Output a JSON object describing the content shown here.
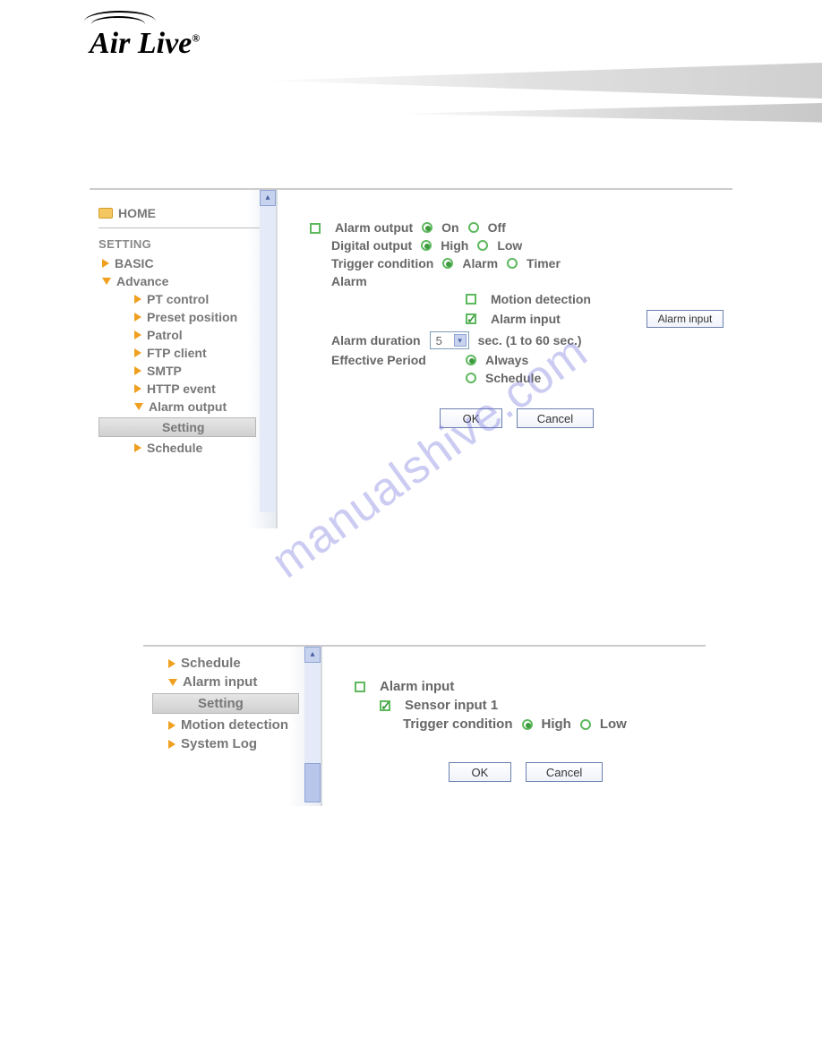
{
  "watermark": "manualshive.com",
  "logo": {
    "text": "Air Live",
    "mark": "®"
  },
  "shot1": {
    "sidebar": {
      "home": "HOME",
      "section": "SETTING",
      "basic": "BASIC",
      "advance": "Advance",
      "items": [
        "PT control",
        "Preset position",
        "Patrol",
        "FTP client",
        "SMTP",
        "HTTP event",
        "Alarm output"
      ],
      "setting": "Setting",
      "schedule": "Schedule"
    },
    "main": {
      "alarm_output_label": "Alarm output",
      "on": "On",
      "off": "Off",
      "digital_output_label": "Digital output",
      "high": "High",
      "low": "Low",
      "trigger_condition_label": "Trigger condition",
      "alarm": "Alarm",
      "timer": "Timer",
      "alarm_heading": "Alarm",
      "motion_detection": "Motion detection",
      "alarm_input": "Alarm input",
      "alarm_input_btn": "Alarm input",
      "alarm_duration_label": "Alarm duration",
      "alarm_duration_value": "5",
      "alarm_duration_suffix": "sec. (1 to 60 sec.)",
      "effective_period_label": "Effective Period",
      "always": "Always",
      "schedule": "Schedule",
      "ok": "OK",
      "cancel": "Cancel"
    }
  },
  "shot2": {
    "sidebar": {
      "items": [
        "Schedule",
        "Alarm input",
        "Setting",
        "Motion detection",
        "System Log"
      ]
    },
    "main": {
      "alarm_input_heading": "Alarm input",
      "sensor_input": "Sensor input 1",
      "trigger_condition_label": "Trigger condition",
      "high": "High",
      "low": "Low",
      "ok": "OK",
      "cancel": "Cancel"
    }
  }
}
